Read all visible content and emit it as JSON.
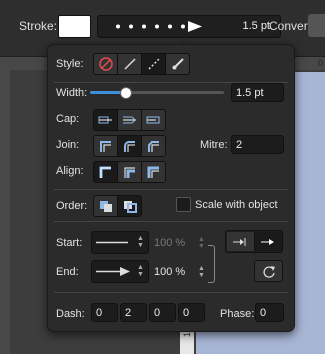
{
  "toolbar": {
    "stroke_label": "Stroke:",
    "stroke_width": "1.5 pt",
    "convert_label": "Convert:"
  },
  "ruler": {
    "top_number": "0",
    "left_number": "100"
  },
  "panel": {
    "style_label": "Style:",
    "width_label": "Width:",
    "width_value": "1.5 pt",
    "width_fraction": 0.26,
    "cap_label": "Cap:",
    "join_label": "Join:",
    "mitre_label": "Mitre:",
    "mitre_value": "2",
    "align_label": "Align:",
    "order_label": "Order:",
    "scale_label": "Scale with object",
    "start_label": "Start:",
    "start_scale": "100 %",
    "end_label": "End:",
    "end_scale": "100 %",
    "dash_label": "Dash:",
    "dash_values": [
      "0",
      "2",
      "0",
      "0"
    ],
    "phase_label": "Phase:",
    "phase_value": "0",
    "selected_style": "dashed-line-icon"
  },
  "colors": {
    "accent": "#3d8fd8",
    "panel": "#2b2b2b",
    "canvas": "#a8b6d6"
  }
}
